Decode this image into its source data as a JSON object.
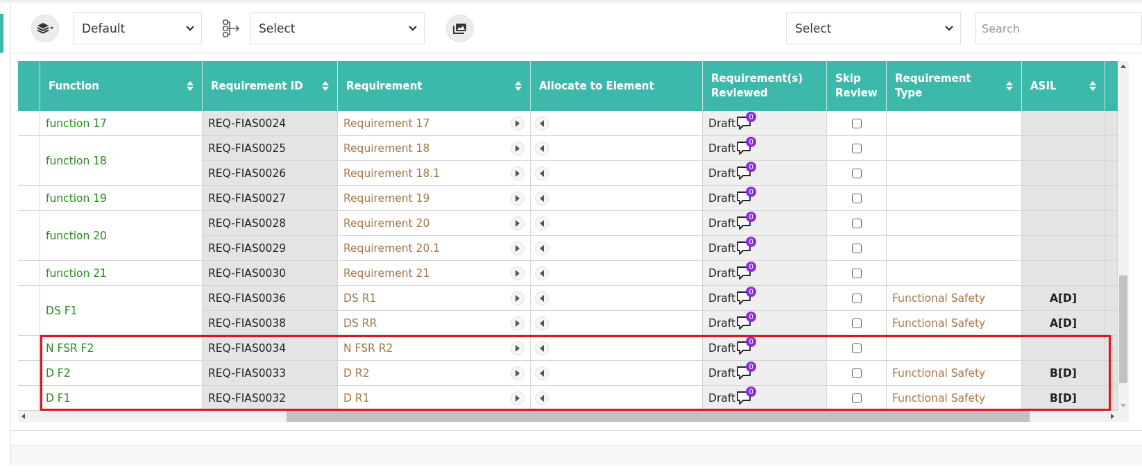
{
  "toolbar": {
    "view_select": "Default",
    "hierarchy_select": "Select",
    "filter_select": "Select",
    "search": {
      "placeholder": "Search"
    }
  },
  "table": {
    "columns": [
      {
        "label": "Function",
        "sortable": true
      },
      {
        "label": "Requirement ID",
        "sortable": true
      },
      {
        "label": "Requirement",
        "sortable": true
      },
      {
        "label": "Allocate to Element",
        "sortable": false
      },
      {
        "label": "Requirement(s) Reviewed",
        "sortable": false
      },
      {
        "label": "Skip Review",
        "sortable": false
      },
      {
        "label": "Requirement Type",
        "sortable": true
      },
      {
        "label": "ASIL",
        "sortable": true
      }
    ],
    "groups": [
      {
        "function": "function 17",
        "highlighted": false,
        "requirements": [
          {
            "id": "REQ-FIAS0024",
            "requirement": "Requirement 17",
            "status": "Draft",
            "comments": "0",
            "skip_review": false
          }
        ]
      },
      {
        "function": "function 18",
        "highlighted": false,
        "requirements": [
          {
            "id": "REQ-FIAS0025",
            "requirement": "Requirement 18",
            "status": "Draft",
            "comments": "0",
            "skip_review": false
          },
          {
            "id": "REQ-FIAS0026",
            "requirement": "Requirement 18.1",
            "status": "Draft",
            "comments": "0",
            "skip_review": false
          }
        ]
      },
      {
        "function": "function 19",
        "highlighted": false,
        "requirements": [
          {
            "id": "REQ-FIAS0027",
            "requirement": "Requirement 19",
            "status": "Draft",
            "comments": "0",
            "skip_review": false
          }
        ]
      },
      {
        "function": "function 20",
        "highlighted": false,
        "requirements": [
          {
            "id": "REQ-FIAS0028",
            "requirement": "Requirement 20",
            "status": "Draft",
            "comments": "0",
            "skip_review": false
          },
          {
            "id": "REQ-FIAS0029",
            "requirement": "Requirement 20.1",
            "status": "Draft",
            "comments": "0",
            "skip_review": false
          }
        ]
      },
      {
        "function": "function 21",
        "highlighted": false,
        "requirements": [
          {
            "id": "REQ-FIAS0030",
            "requirement": "Requirement 21",
            "status": "Draft",
            "comments": "0",
            "skip_review": false
          }
        ]
      },
      {
        "function": "DS F1",
        "highlighted": false,
        "requirements": [
          {
            "id": "REQ-FIAS0036",
            "requirement": "DS R1",
            "status": "Draft",
            "comments": "0",
            "skip_review": false,
            "type": "Functional Safety",
            "asil": "A[D]"
          },
          {
            "id": "REQ-FIAS0038",
            "requirement": "DS RR",
            "status": "Draft",
            "comments": "0",
            "skip_review": false,
            "type": "Functional Safety",
            "asil": "A[D]"
          }
        ]
      },
      {
        "function": "N FSR F2",
        "highlighted": true,
        "requirements": [
          {
            "id": "REQ-FIAS0034",
            "requirement": "N FSR R2",
            "status": "Draft",
            "comments": "0",
            "skip_review": false
          }
        ]
      },
      {
        "function": "D F2",
        "highlighted": true,
        "requirements": [
          {
            "id": "REQ-FIAS0033",
            "requirement": "D R2",
            "status": "Draft",
            "comments": "0",
            "skip_review": false,
            "type": "Functional Safety",
            "asil": "B[D]"
          }
        ]
      },
      {
        "function": "D F1",
        "highlighted": true,
        "requirements": [
          {
            "id": "REQ-FIAS0032",
            "requirement": "D R1",
            "status": "Draft",
            "comments": "0",
            "skip_review": false,
            "type": "Functional Safety",
            "asil": "B[D]"
          }
        ]
      }
    ]
  }
}
